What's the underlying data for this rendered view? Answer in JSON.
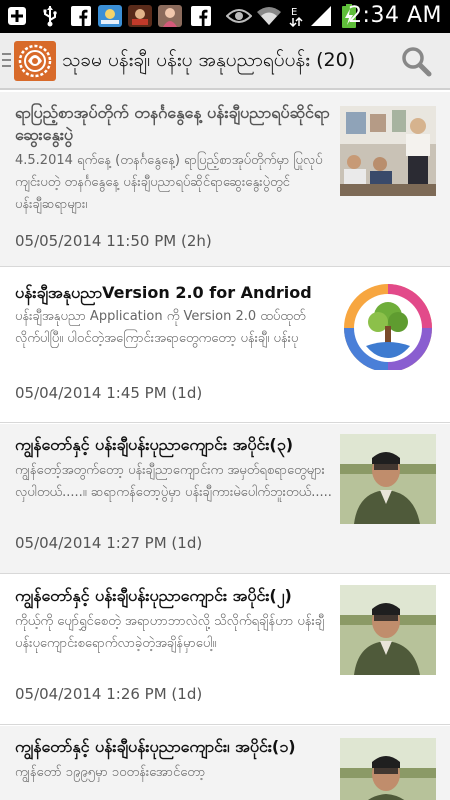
{
  "status_bar": {
    "time": "2:34 AM",
    "icons": [
      "plus-box-icon",
      "usb-icon",
      "facebook-icon",
      "app-icon",
      "app-icon",
      "app-icon",
      "facebook-icon",
      "eye-icon",
      "wifi-icon",
      "network-icon",
      "signal-icon",
      "battery-charging-icon"
    ]
  },
  "action_bar": {
    "title": "သုခမ ပန်းချီ၊ ပန်းပု အနုပညာရပ်ပန်း (20)",
    "search_icon": "search-icon",
    "nav_icon": "drawer-indicator-icon"
  },
  "colors": {
    "status_bg": "#000000",
    "action_bg": "#ededed",
    "alt_row_bg": "#f3f3f3",
    "title_text": "#111111",
    "summary_text": "#666666"
  },
  "articles": [
    {
      "title": "ရာပြည့်စာအုပ်တိုက် တနင်္ဂနွေနေ့ ပန်းချီပညာရပ်ဆိုင်ရာဆွေးနွေးပွဲ",
      "summary": "4.5.2014 ရက်နေ့ (တနင်္ဂနွေနေ့) ရာပြည့်စာအုပ်တိုက်မှာ ပြုလုပ်ကျင်းပတဲ့ တနင်္ဂနွေနေ့ ပန်းချီပညာရပ်ဆိုင်ရာဆွေးနွေးပွဲတွင် ပန်းချီဆရာများ၊",
      "date": "05/05/2014 11:50 PM (2h)",
      "thumb": "event-photo-image"
    },
    {
      "title": "ပန်းချီအနုပညာVersion 2.0 for Andriod",
      "summary": "ပန်းချီအနုပညာ Application ကို Version 2.0 ထပ်ထုတ်လိုက်ပါပြီ။ ပါဝင်တဲ့အကြောင်းအရာတွေကတော့ ပန်းချီ၊ ပန်းပု",
      "date": "05/04/2014 1:45 PM (1d)",
      "thumb": "app-logo-tree-image"
    },
    {
      "title": "ကျွန်တော်နှင့် ပန်းချီပန်းပုညာကျောင်း အပိုင်း(၃)",
      "summary": "ကျွန်တော့်အတွက်တော့ ပန်းချီညာကျောင်းက အမှတ်ရစရာတွေများလှပါတယ်.....။ ဆရာကန်တော့ပွဲမှာ ပန်းချီကားမဲပေါက်ဘူးတယ်.....",
      "date": "05/04/2014 1:27 PM (1d)",
      "thumb": "portrait-photo-image"
    },
    {
      "title": "ကျွန်တော်နှင့် ပန်းချီပန်းပုညာကျောင်း အပိုင်း(၂)",
      "summary": "ကိုယ့်ကို ပျော်ရွှင်စေတဲ့ အရာဟာဘာလဲလို့ သိလိုက်ရချိန်ဟာ ပန်းချီပန်းပုကျောင်းစရောက်လာခဲ့တဲ့အချိန်မှာပေါ့။",
      "date": "05/04/2014 1:26 PM (1d)",
      "thumb": "portrait-photo-image"
    },
    {
      "title": "ကျွန်တော်နှင့် ပန်းချီပန်းပုညာကျောင်း၊ အပိုင်း(၁)",
      "summary": "ကျွန်တော် ၁၉၉၅မှာ ၁၀တန်းအောင်တော့",
      "date": "",
      "thumb": "portrait-photo-image"
    }
  ]
}
